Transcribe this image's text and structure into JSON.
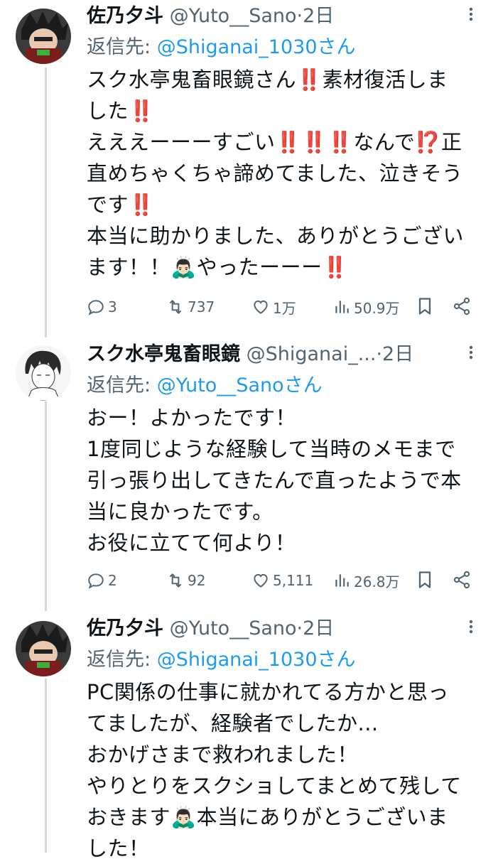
{
  "tweets": [
    {
      "name": "佐乃夕斗",
      "handle": "@Yuto__Sano",
      "dot": "·",
      "time": "2日",
      "reply_prefix": "返信先: ",
      "reply_mention": "@Shiganai_1030さん",
      "body": "スク水亭鬼畜眼鏡さん‼️素材復活しま\nした‼️\nえええーーーすごい‼️‼️‼️なんで⁉️正\n直めちゃくちゃ諦めてました、泣きそう\nです‼️\n本当に助かりました、ありがとうござい\nます！！🙇🏻‍♂️やったーーー‼️",
      "counts": {
        "replies": "3",
        "retweets": "737",
        "likes": "1万",
        "views": "50.9万"
      }
    },
    {
      "name": "スク水亭鬼畜眼鏡",
      "handle": "@Shiganai_...",
      "dot": "·",
      "time": "2日",
      "reply_prefix": "返信先: ",
      "reply_mention": "@Yuto__Sanoさん",
      "body": "おー！よかったです！\n1度同じような経験して当時のメモまで\n引っ張り出してきたんで直ったようで本\n当に良かったです。\nお役に立てて何より！",
      "counts": {
        "replies": "2",
        "retweets": "92",
        "likes": "5,111",
        "views": "26.8万"
      }
    },
    {
      "name": "佐乃夕斗",
      "handle": "@Yuto__Sano",
      "dot": "·",
      "time": "2日",
      "reply_prefix": "返信先: ",
      "reply_mention": "@Shiganai_1030さん",
      "body": "PC関係の仕事に就かれてる方かと思っ\nてましたが、経験者でしたか...\nおかげさまで救われました！\nやりとりをスクショしてまとめて残して\nおきます🙇🏻‍♂️本当にありがとうございま\nした！"
    }
  ],
  "colors": {
    "text": "#0f1419",
    "muted": "#536471",
    "link": "#1d9bf0",
    "thread_line": "#cfd9de"
  },
  "icons": [
    "more-icon",
    "reply-icon",
    "retweet-icon",
    "like-icon",
    "views-icon",
    "bookmark-icon",
    "share-icon"
  ]
}
